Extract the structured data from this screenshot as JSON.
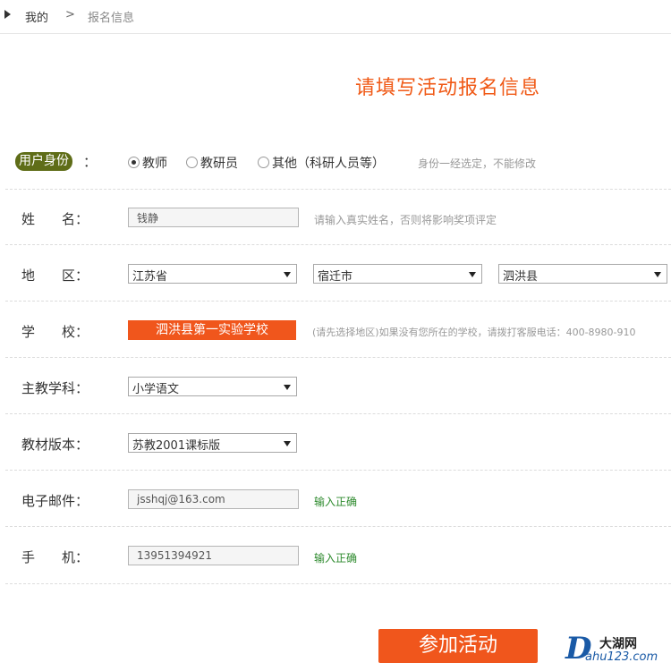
{
  "breadcrumb": {
    "home": "我的",
    "separator": ">",
    "current": "报名信息"
  },
  "page_title": "请填写活动报名信息",
  "identity": {
    "label": "用户身份",
    "colon": "：",
    "options": [
      "教师",
      "教研员",
      "其他（科研人员等）"
    ],
    "selected": "教师",
    "hint": "身份一经选定，不能修改"
  },
  "name": {
    "label": "姓　　名：",
    "value": "钱静",
    "hint": "请输入真实姓名，否则将影响奖项评定"
  },
  "region": {
    "label": "地　　区：",
    "province": "江苏省",
    "city": "宿迁市",
    "county": "泗洪县"
  },
  "school": {
    "label": "学　　校：",
    "button": "泗洪县第一实验学校",
    "hint": "(请先选择地区)如果没有您所在的学校，请拨打客服电话：400-8980-910"
  },
  "subject": {
    "label": "主教学科：",
    "value": "小学语文"
  },
  "textbook": {
    "label": "教材版本：",
    "value": "苏教2001课标版"
  },
  "email": {
    "label": "电子邮件：",
    "value": "jsshqj@163.com",
    "status": "输入正确"
  },
  "phone": {
    "label": "手　　机：",
    "value": "13951394921",
    "status": "输入正确"
  },
  "submit": "参加活动",
  "watermark": {
    "letter": "D",
    "name": "大湖网",
    "url": "ahu123.com"
  }
}
